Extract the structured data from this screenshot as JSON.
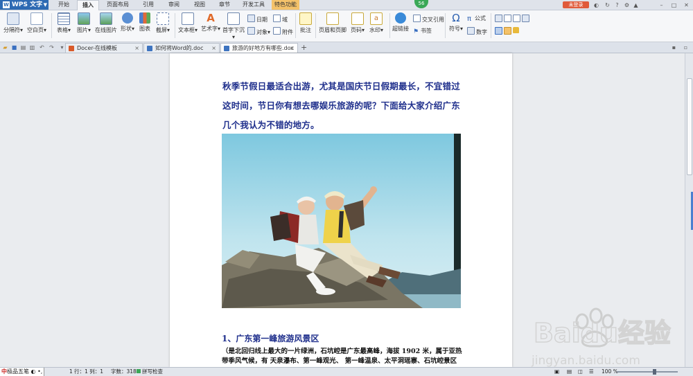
{
  "app": {
    "name": "WPS 文字"
  },
  "menu": {
    "tabs": [
      "开始",
      "插入",
      "页面布局",
      "引用",
      "审阅",
      "视图",
      "章节",
      "开发工具",
      "特色功能"
    ],
    "active": "插入",
    "badge": "56",
    "login": "未登录"
  },
  "ribbon": {
    "page_break": "分隔符",
    "blank_page": "空白页",
    "table": "表格",
    "picture": "图片",
    "online_picture": "在线图片",
    "shape": "形状",
    "chart": "图表",
    "screenshot": "截屏",
    "textbox": "文本框",
    "wordart": "艺术字",
    "dropcap": "首字下沉",
    "date": "日期",
    "field": "域",
    "object": "对象",
    "attachment": "附件",
    "comment": "批注",
    "header_footer": "页眉和页脚",
    "page_number": "页码",
    "watermark": "水印",
    "hyperlink": "超链接",
    "cross_ref": "交叉引用",
    "bookmark": "书签",
    "symbol": "符号",
    "formula": "公式",
    "number": "数字"
  },
  "tabs": [
    {
      "label": "Docer-在线模板"
    },
    {
      "label": "如何将Word的.doc"
    },
    {
      "label": "旅游的好地方有哪些.doc"
    }
  ],
  "document": {
    "intro": "秋季节假日最适合出游，尤其是国庆节日假期最长，不宜错过这时间，节日你有想去哪娱乐旅游的呢？下面给大家介绍广东几个我认为不错的地方。",
    "heading1": "1、广东第一峰旅游风景区",
    "body": "（是北回归线上最大的一片绿洲，石坑崆是广东最高峰，海拔 1902 米，属于亚热带季风气候，有 天泉瀑布、第一峰观光、 第一峰温泉、太平洞瑶寨、石坑崆景区"
  },
  "status": {
    "ime": "极品五笔",
    "row": "1 行：1 列：1",
    "words": "字数：318",
    "spell": "拼写检查",
    "zoom": "100 %"
  },
  "watermark": {
    "brand": "Baidu经验",
    "url": "jingyan.baidu.com"
  },
  "colors": {
    "title_blue": "#1f2f8c",
    "accent": "#2d6ab3",
    "login": "#e05a3a"
  }
}
